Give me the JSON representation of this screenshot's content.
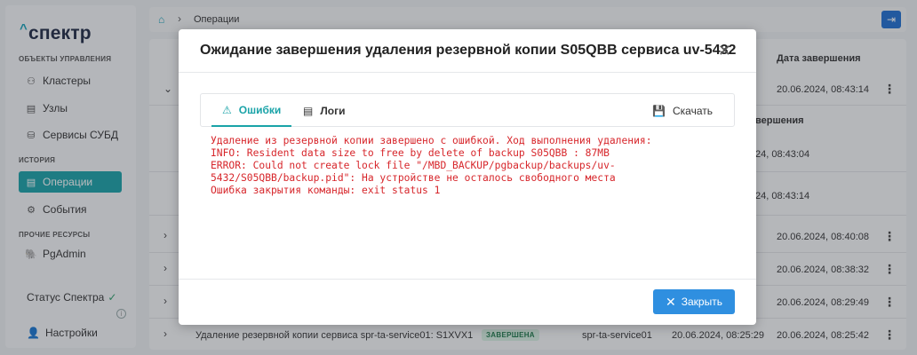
{
  "app": {
    "logo": "спектр",
    "sidebar": {
      "section_objects": "ОБЪЕКТЫ УПРАВЛЕНИЯ",
      "items_objects": [
        {
          "label": "Кластеры",
          "icon": "cluster-icon"
        },
        {
          "label": "Узлы",
          "icon": "server-icon"
        },
        {
          "label": "Сервисы СУБД",
          "icon": "database-icon"
        }
      ],
      "section_history": "ИСТОРИЯ",
      "items_history": [
        {
          "label": "Операции",
          "icon": "operations-icon",
          "active": true
        },
        {
          "label": "События",
          "icon": "gear-icon"
        }
      ],
      "section_other": "ПРОЧИЕ РЕСУРСЫ",
      "items_other": [
        {
          "label": "PgAdmin",
          "icon": "pgadmin-icon"
        }
      ],
      "status_label": "Статус Спектра",
      "status_ok": "✓",
      "info_badge": "i",
      "settings_label": "Настройки"
    },
    "breadcrumb": {
      "current": "Операции"
    },
    "table": {
      "header_end_date": "Дата завершения",
      "subheader_end": "вершения",
      "rows": [
        {
          "end": "20.06.2024, 08:43:14"
        },
        {
          "end": "24, 08:43:04"
        },
        {
          "end": "24, 08:43:14"
        },
        {
          "end": "20.06.2024, 08:40:08"
        },
        {
          "end": "20.06.2024, 08:38:32"
        },
        {
          "end": "20.06.2024, 08:29:49"
        }
      ],
      "last_row": {
        "name": "Удаление резервной копии сервиса spr-ta-service01: S1XVX1",
        "status": "ЗАВЕРШЕНА",
        "service": "spr-ta-service01",
        "start": "20.06.2024, 08:25:29",
        "end": "20.06.2024, 08:25:42"
      }
    }
  },
  "modal": {
    "title": "Ожидание завершения удаления резервной копии S05QBB сервиса uv-5432",
    "tabs": [
      {
        "label": "Ошибки",
        "icon": "warning-icon",
        "active": true
      },
      {
        "label": "Логи",
        "icon": "document-icon",
        "active": false
      }
    ],
    "download_label": "Скачать",
    "log_text": "Удаление из резервной копии завершено с ошибкой. Ход выполнения удаления:\nINFO: Resident data size to free by delete of backup S05QBB : 87MB\nERROR: Could not create lock file \"/MBD_BACKUP/pgbackup/backups/uv-\n5432/S05QBB/backup.pid\": На устройстве не осталось свободного места\nОшибка закрытия команды: exit status 1",
    "close_button": "Закрыть"
  },
  "colors": {
    "accent": "#1aa3a8",
    "primary_button": "#2f8fe0",
    "error_text": "#d7262b"
  }
}
